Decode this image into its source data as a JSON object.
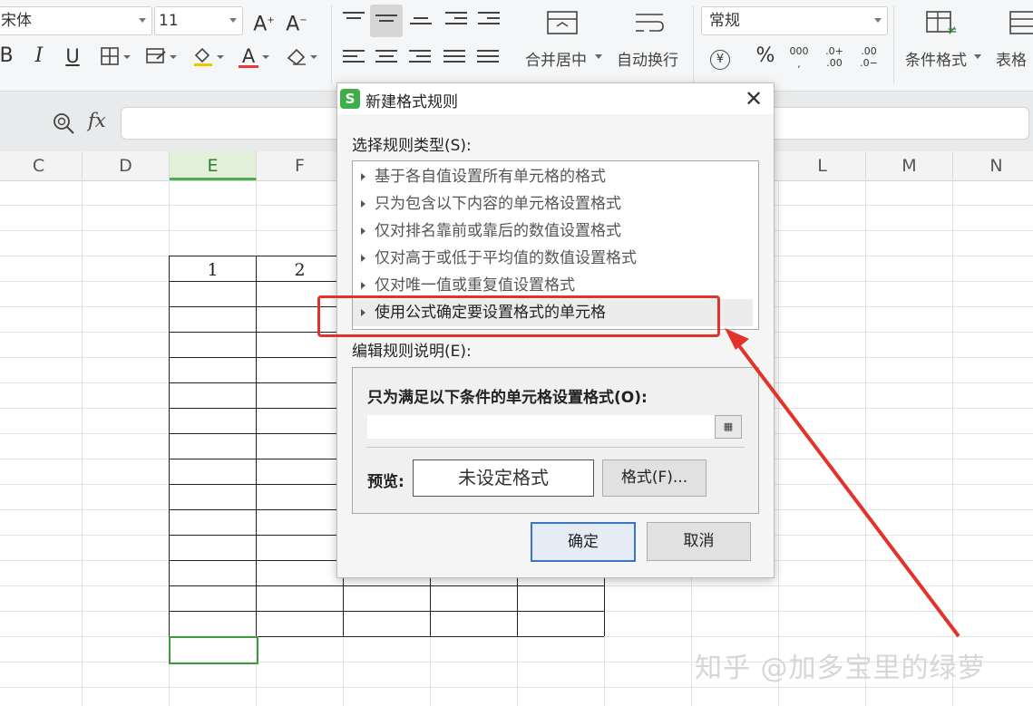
{
  "ribbon": {
    "font_name": "宋体",
    "font_size": "11",
    "number_format": "常规",
    "merge_center_label": "合并居中",
    "wrap_text_label": "自动换行",
    "conditional_format_label": "条件格式",
    "table_style_label": "表格",
    "bold_label": "B",
    "italic_label": "I",
    "underline_label": "U",
    "percent_label": "%",
    "currency_label": "¥",
    "increase_font_label": "A",
    "decrease_font_label": "A",
    "font_color_label": "A"
  },
  "formula_bar": {
    "fx_label": "fx",
    "value": ""
  },
  "sheet": {
    "columns": [
      "C",
      "D",
      "E",
      "F",
      "L",
      "M",
      "N"
    ],
    "active_column": "E",
    "cell_values": [
      "1",
      "2"
    ]
  },
  "dialog": {
    "title": "新建格式规则",
    "app_badge": "S",
    "close_symbol": "✕",
    "rule_type_label": "选择规则类型(S):",
    "rule_types": [
      "基于各自值设置所有单元格的格式",
      "只为包含以下内容的单元格设置格式",
      "仅对排名靠前或靠后的数值设置格式",
      "仅对高于或低于平均值的数值设置格式",
      "仅对唯一值或重复值设置格式",
      "使用公式确定要设置格式的单元格"
    ],
    "selected_rule_index": 5,
    "edit_desc_label": "编辑规则说明(E):",
    "condition_label": "只为满足以下条件的单元格设置格式(O):",
    "formula_value": "",
    "preview_label": "预览:",
    "preview_text": "未设定格式",
    "format_button": "格式(F)...",
    "ok_button": "确定",
    "cancel_button": "取消"
  },
  "watermark": "知乎 @加多宝里的绿萝",
  "colors": {
    "highlight": "#e2332a",
    "app_green": "#3fae49",
    "active_col": "#4caf50"
  }
}
